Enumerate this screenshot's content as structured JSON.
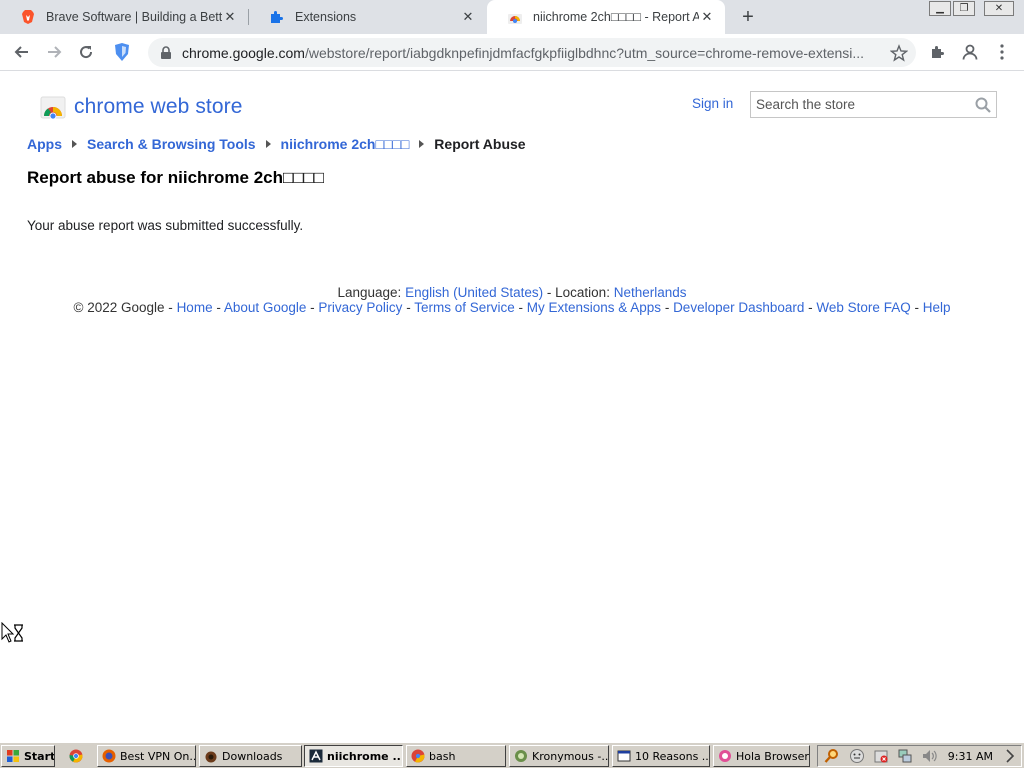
{
  "browser": {
    "tabs": [
      {
        "title": "Brave Software | Building a Better",
        "icon": "brave-lion-icon"
      },
      {
        "title": "Extensions",
        "icon": "puzzle-icon"
      },
      {
        "title": "niichrome 2ch□□□□ - Report Abuse",
        "icon": "webstore-icon"
      }
    ],
    "url_host": "chrome.google.com",
    "url_path": "/webstore/report/iabgdknpefinjdmfacfgkpfiiglbdhnc?utm_source=chrome-remove-extensi..."
  },
  "header": {
    "store_title": "chrome web store",
    "sign_in": "Sign in",
    "search_placeholder": "Search the store"
  },
  "breadcrumb": [
    "Apps",
    "Search & Browsing Tools",
    "niichrome 2ch□□□□",
    "Report Abuse"
  ],
  "main": {
    "heading": "Report abuse for niichrome 2ch□□□□",
    "message": "Your abuse report was submitted successfully."
  },
  "footer": {
    "language_label": "Language:",
    "language_value": "English (United States)",
    "location_label": "- Location:",
    "location_value": "Netherlands",
    "copyright": "© 2022 Google -",
    "links": [
      "Home",
      "About Google",
      "Privacy Policy",
      "Terms of Service",
      "My Extensions & Apps",
      "Developer Dashboard",
      "Web Store FAQ",
      "Help"
    ]
  },
  "taskbar": {
    "start": "Start",
    "buttons": [
      "Best VPN On...",
      "Downloads",
      "niichrome ...",
      "bash",
      "Kronymous -...",
      "10 Reasons ...",
      "Hola Browser"
    ],
    "clock": "9:31 AM"
  },
  "colors": {
    "link": "#3367d6",
    "tabstrip": "#dee1e6",
    "taskbar": "#d4d0c8"
  }
}
